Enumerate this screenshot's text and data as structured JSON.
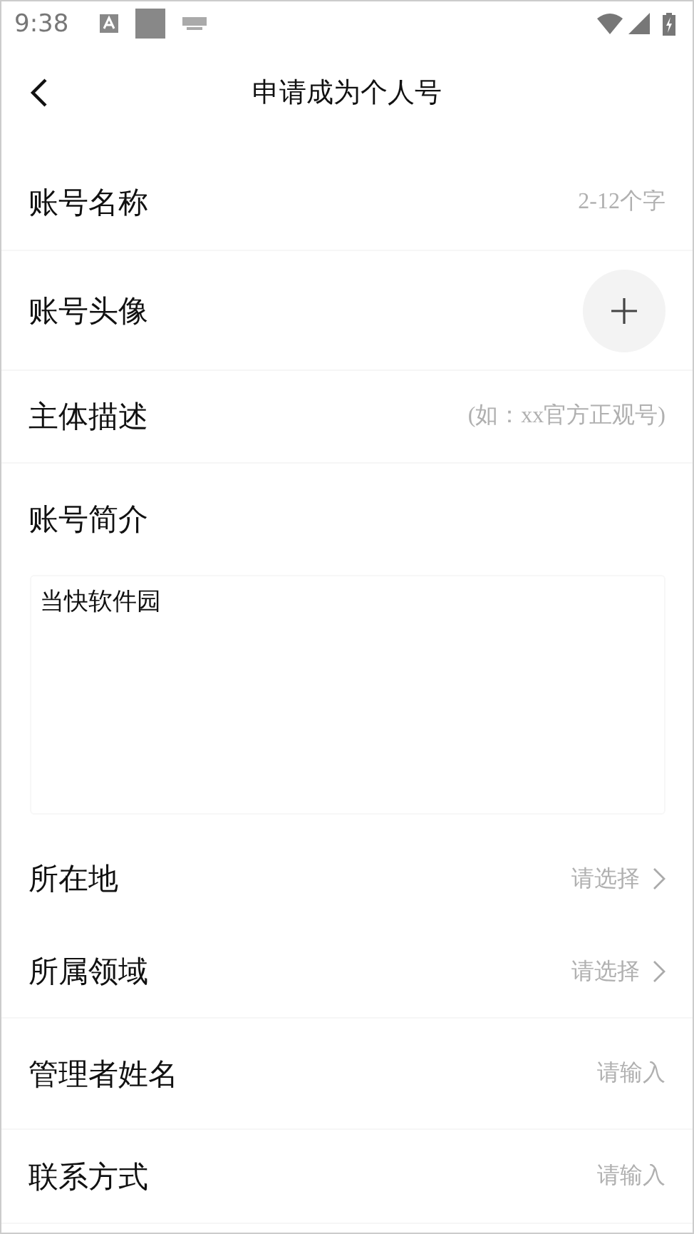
{
  "status_bar": {
    "time": "9:38"
  },
  "header": {
    "title": "申请成为个人号"
  },
  "form": [
    {
      "kind": "input",
      "label": "账号名称",
      "placeholder": "2-12个字"
    },
    {
      "kind": "avatar",
      "label": "账号头像"
    },
    {
      "kind": "input",
      "label": "主体描述",
      "placeholder": "(如：xx官方正观号)"
    },
    {
      "kind": "textarea",
      "label": "账号简介",
      "value": "当快软件园"
    },
    {
      "kind": "select",
      "label": "所在地",
      "placeholder": "请选择"
    },
    {
      "kind": "select",
      "label": "所属领域",
      "placeholder": "请选择"
    },
    {
      "kind": "input",
      "label": "管理者姓名",
      "placeholder": "请输入"
    },
    {
      "kind": "input",
      "label": "联系方式",
      "placeholder": "请输入"
    }
  ]
}
